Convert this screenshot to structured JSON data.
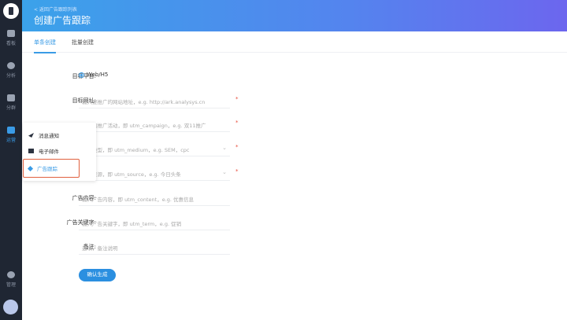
{
  "sidebar": {
    "items": [
      {
        "label": "看板",
        "icon": "dashboard-icon"
      },
      {
        "label": "分析",
        "icon": "pie-chart-icon"
      },
      {
        "label": "分群",
        "icon": "users-icon"
      },
      {
        "label": "运营",
        "icon": "monitor-icon",
        "active": true
      },
      {
        "label": "管理",
        "icon": "gear-icon"
      }
    ]
  },
  "header": {
    "back": "< 返回广告跟踪列表",
    "title": "创建广告跟踪"
  },
  "tabs": [
    "单条创建",
    "批量创建"
  ],
  "form": {
    "platform": {
      "label": "目标平台:",
      "option": "Web/H5"
    },
    "url": {
      "label": "目标网址:",
      "placeholder": "输入要推广的网站地址，e.g. http://ark.analysys.cn"
    },
    "campaign": {
      "placeholder": "确定的推广活动，即 utm_campaign，e.g. 双11推广"
    },
    "medium": {
      "placeholder": "推广类型，即 utm_medium，e.g. SEM，cpc"
    },
    "source": {
      "placeholder": "推广来源，即 utm_source，e.g. 今日头条"
    },
    "content": {
      "label": "广告内容:",
      "placeholder": "输入广告内容，即 utm_content，e.g. 优惠信息"
    },
    "term": {
      "label": "广告关键字:",
      "placeholder": "输入广告关键字，即 utm_term，e.g. 促销"
    },
    "note": {
      "label": "备注:",
      "placeholder": "选填，备注说明"
    },
    "required": "*",
    "submit": "确认生成"
  },
  "popup": {
    "items": [
      "消息通知",
      "电子邮件",
      "广告跟踪"
    ]
  }
}
